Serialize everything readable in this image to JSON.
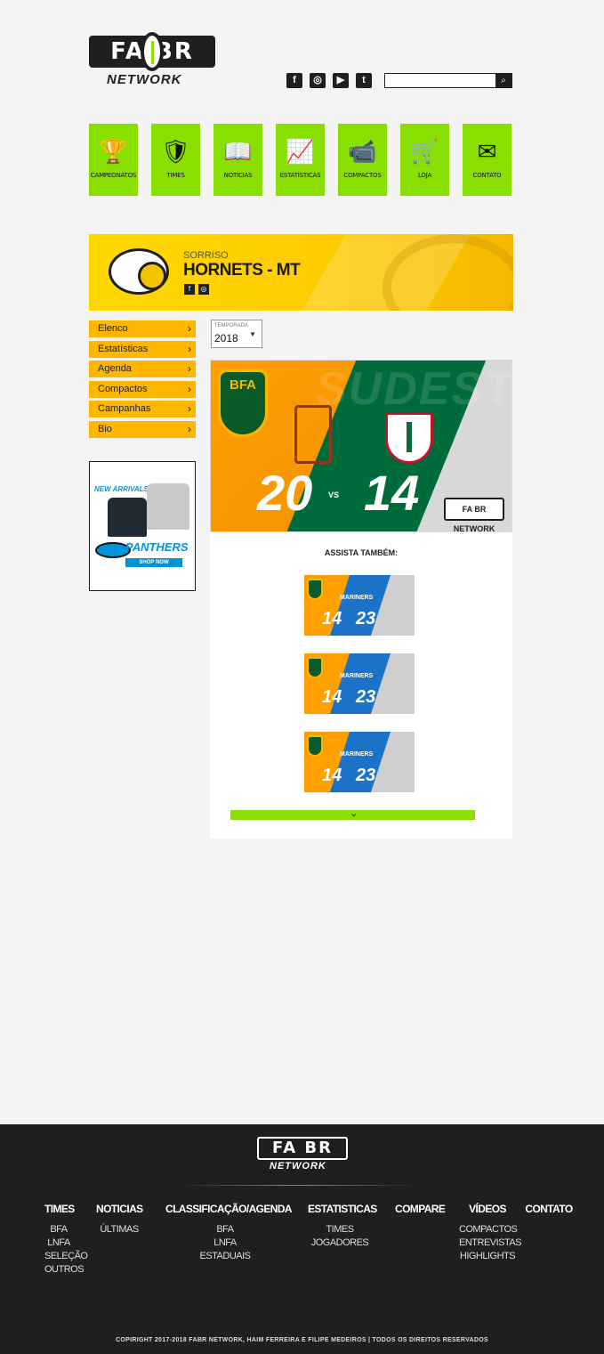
{
  "header": {
    "logo_top": "FA BR",
    "logo_bottom": "NETWORK",
    "social": [
      "f",
      "ig",
      "yt",
      "tw"
    ],
    "search": {
      "value": "",
      "placeholder": "",
      "button_icon": "search-icon"
    }
  },
  "nav": [
    {
      "label": "CAMPEONATOS",
      "icon": "trophy-icon",
      "glyph": "🏆"
    },
    {
      "label": "TIMES",
      "icon": "shield-icon",
      "glyph": "🛡"
    },
    {
      "label": "NOTÍCIAS",
      "icon": "book-icon",
      "glyph": "📖"
    },
    {
      "label": "ESTATÍSTICAS",
      "icon": "chart-icon",
      "glyph": "📈"
    },
    {
      "label": "COMPACTOS",
      "icon": "video-camera-icon",
      "glyph": "📹"
    },
    {
      "label": "LOJA",
      "icon": "cart-icon",
      "glyph": "🛒"
    },
    {
      "label": "CONTATO",
      "icon": "envelope-icon",
      "glyph": "✉"
    }
  ],
  "team": {
    "city": "SORRISO",
    "name": "HORNETS - MT"
  },
  "side_menu": [
    "Elenco",
    "Estatísticas",
    "Agenda",
    "Compactos",
    "Campanhas",
    "Bio"
  ],
  "ad": {
    "arrivals": "NEW ARRIVALS",
    "brand": "PANTHERS",
    "cta": "SHOP NOW"
  },
  "season": {
    "caption": "TEMPORADA",
    "value": "2018"
  },
  "video": {
    "league": "BFA",
    "watermark": "SUDESTE",
    "score_home": "20",
    "vs": "VS",
    "score_away": "14",
    "badge": "FA BR NETWORK"
  },
  "also": {
    "title": "ASSISTA TAMBÉM:",
    "items": [
      {
        "team": "MARINERS",
        "s1": "14",
        "s2": "23"
      },
      {
        "team": "MARINERS",
        "s1": "14",
        "s2": "23"
      },
      {
        "team": "MARINERS",
        "s1": "14",
        "s2": "23"
      }
    ]
  },
  "footer": {
    "logo_top": "FA BR",
    "logo_bottom": "NETWORK",
    "columns": [
      {
        "title": "TIMES",
        "links": [
          "BFA",
          "LNFA",
          "SELEÇÃO",
          "OUTROS"
        ]
      },
      {
        "title": "NOTICIAS",
        "links": [
          "ÚLTIMAS"
        ]
      },
      {
        "title": "CLASSIFICAÇÃO/AGENDA",
        "links": [
          "BFA",
          "LNFA",
          "ESTADUAIS"
        ]
      },
      {
        "title": "ESTATISTICAS",
        "links": [
          "TIMES",
          "JOGADORES"
        ]
      },
      {
        "title": "COMPARE",
        "links": []
      },
      {
        "title": "VÍDEOS",
        "links": [
          "COMPACTOS",
          "ENTREVISTAS",
          "HIGHLIGHTS"
        ]
      },
      {
        "title": "CONTATO",
        "links": []
      }
    ],
    "copyright": "COPIRIGHT 2017-2018 FABR NETWORK, HAIM FERREIRA E FILIPE MEDEIROS | TODOS OS DIREITOS RESERVADOS"
  },
  "colors": {
    "accent_green": "#89e000",
    "accent_yellow": "#ffb700",
    "dark": "#1f1f21"
  }
}
